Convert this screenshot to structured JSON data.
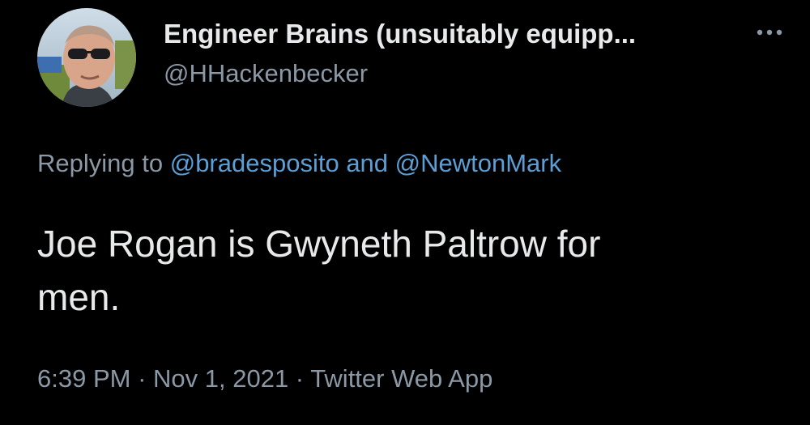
{
  "tweet": {
    "author": {
      "display_name": "Engineer Brains (unsuitably equipp...",
      "handle": "@HHackenbecker",
      "avatar_icon": "profile-photo-avatar"
    },
    "more_icon": "more-options-icon",
    "reply": {
      "prefix": "Replying to ",
      "mentions": [
        "@bradesposito",
        "@NewtonMark"
      ],
      "conjunction": " and "
    },
    "text_lines": [
      "Joe Rogan is Gwyneth Paltrow for",
      "men."
    ],
    "meta": {
      "time": "6:39 PM",
      "separator": " · ",
      "date": "Nov 1, 2021",
      "source": "Twitter Web App"
    },
    "colors": {
      "background": "#000000",
      "primary_text": "#e7e9ea",
      "secondary_text": "#8b98a5",
      "link": "#5b9fd6"
    }
  }
}
